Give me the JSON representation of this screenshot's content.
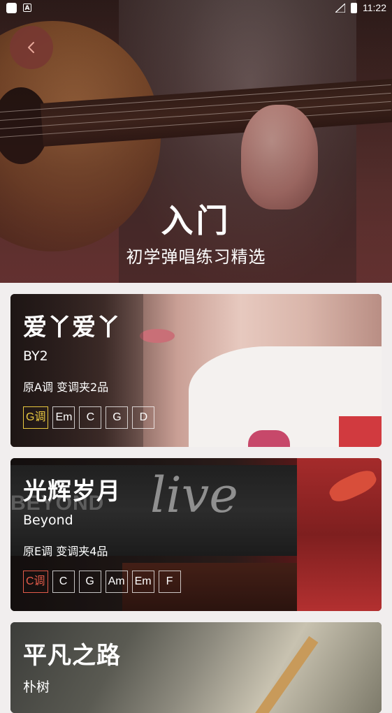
{
  "status_bar": {
    "time": "11:22",
    "notif_icon": "A"
  },
  "hero": {
    "title": "入门",
    "subtitle": "初学弹唱练习精选"
  },
  "songs": [
    {
      "title": "爱丫爱丫",
      "artist": "BY2",
      "key_info": "原A调 变调夹2品",
      "chords": [
        {
          "label": "G调",
          "highlight": true,
          "color": "#e8c840"
        },
        {
          "label": "Em"
        },
        {
          "label": "C"
        },
        {
          "label": "G"
        },
        {
          "label": "D"
        }
      ]
    },
    {
      "title": "光辉岁月",
      "artist": "Beyond",
      "key_info": "原E调 变调夹4品",
      "chords": [
        {
          "label": "C调",
          "highlight": true,
          "color": "#e25b4a"
        },
        {
          "label": "C"
        },
        {
          "label": "G"
        },
        {
          "label": "Am"
        },
        {
          "label": "Em"
        },
        {
          "label": "F"
        }
      ]
    },
    {
      "title": "平凡之路",
      "artist": "朴树"
    }
  ],
  "card2_art": {
    "big_text": "live",
    "band_text": "BEYOND"
  }
}
